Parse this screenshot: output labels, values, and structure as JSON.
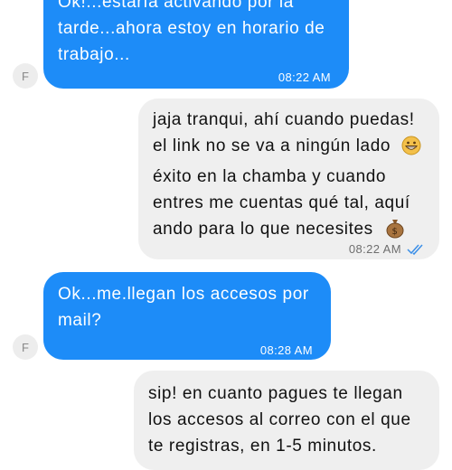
{
  "messages": [
    {
      "from": "contact",
      "avatar_letter": "F",
      "lines": [
        "Ok!...estaría activando por la",
        "tarde...ahora estoy en horario de",
        "trabajo..."
      ],
      "time": "08:22 AM"
    },
    {
      "from": "me",
      "lines": [
        "jaja tranqui, ahí cuando puedas!",
        "el link no se va a ningún lado",
        "éxito en la chamba y cuando",
        "entres me cuentas qué tal, aquí",
        "ando para lo que necesites"
      ],
      "emojis": [
        "grinning-face-emoji",
        "money-bag-emoji"
      ],
      "time": "08:22 AM",
      "status": "double-check-read-icon"
    },
    {
      "from": "contact",
      "avatar_letter": "F",
      "lines": [
        "Ok...me.llegan los accesos por",
        "mail?"
      ],
      "time": "08:28 AM"
    },
    {
      "from": "me",
      "lines": [
        "sip! en cuanto pagues te llegan",
        "los accesos al correo con el que",
        "te registras, en 1-5 minutos."
      ]
    }
  ],
  "colors": {
    "incoming_bubble": "#1d8cf8",
    "outgoing_bubble": "#efefef",
    "read_check": "#3b8fe8"
  }
}
